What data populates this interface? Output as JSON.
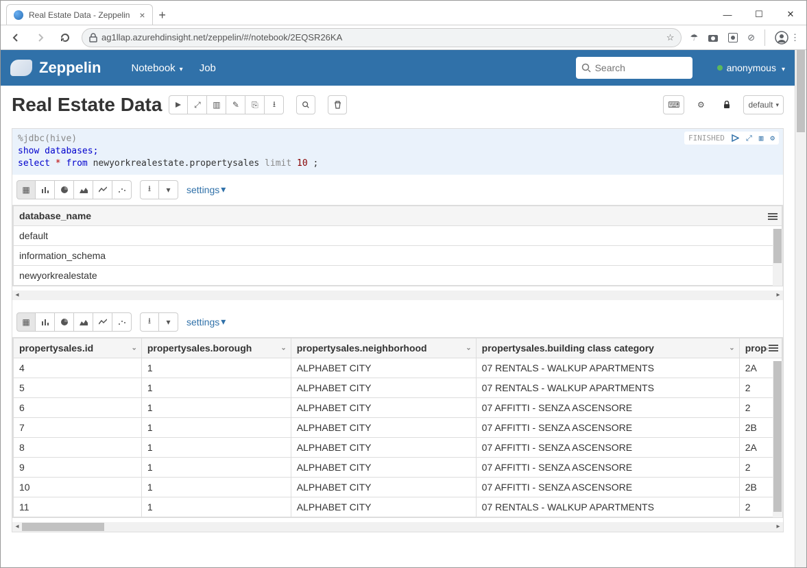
{
  "browser": {
    "tab_title": "Real Estate Data - Zeppelin",
    "url": "ag1llap.azurehdinsight.net/zeppelin/#/notebook/2EQSR26KA"
  },
  "header": {
    "brand": "Zeppelin",
    "nav": {
      "notebook": "Notebook",
      "job": "Job"
    },
    "search_placeholder": "Search",
    "user": "anonymous"
  },
  "notebook": {
    "title": "Real Estate Data",
    "mode_label": "default"
  },
  "paragraph": {
    "status": "FINISHED",
    "code": {
      "l1": "%jdbc(hive)",
      "l2": "show databases;",
      "l3_pre": "select ",
      "l3_star": "*",
      "l3_from": " from ",
      "l3_tbl": "newyorkrealestate.propertysales ",
      "l3_limit": "limit ",
      "l3_num": "10",
      "l3_end": " ;"
    },
    "settings_label": "settings"
  },
  "result1": {
    "header": "database_name",
    "rows": [
      "default",
      "information_schema",
      "newyorkrealestate"
    ]
  },
  "result2": {
    "headers": [
      "propertysales.id",
      "propertysales.borough",
      "propertysales.neighborhood",
      "propertysales.building class category",
      "proper"
    ],
    "rows": [
      {
        "id": "4",
        "borough": "1",
        "neighborhood": "ALPHABET CITY",
        "bcc": "07 RENTALS - WALKUP APARTMENTS",
        "c5": "2A"
      },
      {
        "id": "5",
        "borough": "1",
        "neighborhood": "ALPHABET CITY",
        "bcc": "07 RENTALS - WALKUP APARTMENTS",
        "c5": "2"
      },
      {
        "id": "6",
        "borough": "1",
        "neighborhood": "ALPHABET CITY",
        "bcc": "07 AFFITTI - SENZA ASCENSORE",
        "c5": "2"
      },
      {
        "id": "7",
        "borough": "1",
        "neighborhood": "ALPHABET CITY",
        "bcc": "07 AFFITTI - SENZA ASCENSORE",
        "c5": "2B"
      },
      {
        "id": "8",
        "borough": "1",
        "neighborhood": "ALPHABET CITY",
        "bcc": "07 AFFITTI - SENZA ASCENSORE",
        "c5": "2A"
      },
      {
        "id": "9",
        "borough": "1",
        "neighborhood": "ALPHABET CITY",
        "bcc": "07 AFFITTI - SENZA ASCENSORE",
        "c5": "2"
      },
      {
        "id": "10",
        "borough": "1",
        "neighborhood": "ALPHABET CITY",
        "bcc": "07 AFFITTI - SENZA ASCENSORE",
        "c5": "2B"
      },
      {
        "id": "11",
        "borough": "1",
        "neighborhood": "ALPHABET CITY",
        "bcc": "07 RENTALS - WALKUP APARTMENTS",
        "c5": "2"
      }
    ]
  }
}
